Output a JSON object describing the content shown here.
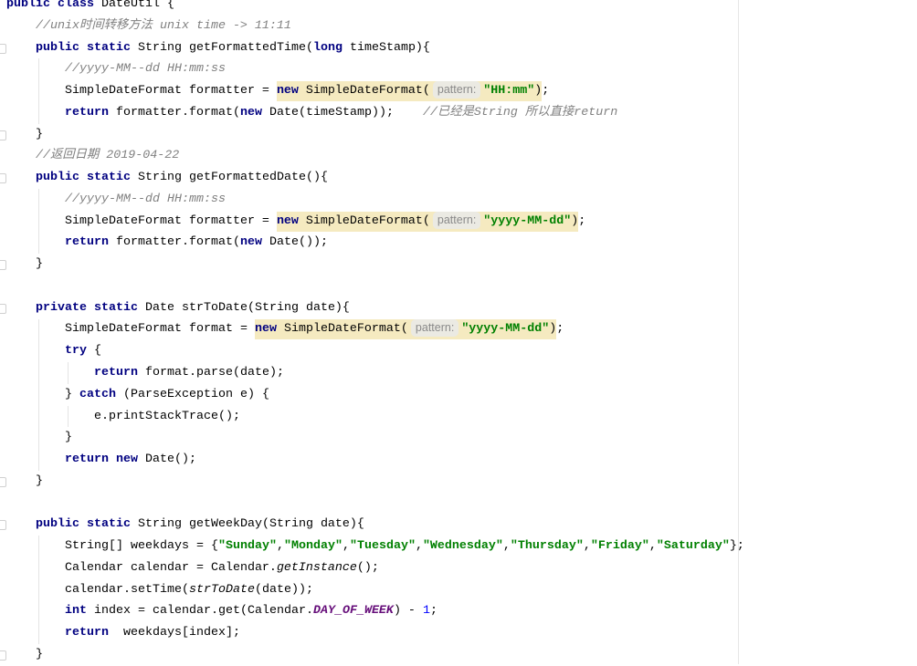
{
  "code_lines": [
    [
      {
        "t": "public class ",
        "c": "kw"
      },
      {
        "t": "DateUtil {"
      }
    ],
    [
      {
        "t": "    "
      },
      {
        "t": "//unix时间转移方法 unix time -> 11:11",
        "c": "cmt"
      }
    ],
    [
      {
        "t": "    "
      },
      {
        "t": "public static ",
        "c": "kw"
      },
      {
        "t": "String getFormattedTime("
      },
      {
        "t": "long ",
        "c": "kw"
      },
      {
        "t": "timeStamp){"
      }
    ],
    [
      {
        "t": "        "
      },
      {
        "t": "//yyyy-MM--dd HH:mm:ss",
        "c": "cmt"
      }
    ],
    [
      {
        "t": "        SimpleDateFormat formatter = "
      },
      {
        "t": "new",
        "c": "kw",
        "hl": true
      },
      {
        "t": " SimpleDateFormat(",
        "hl": true
      },
      {
        "t": "pattern:",
        "c": "hint",
        "hl": true
      },
      {
        "t": "\"HH:mm\"",
        "c": "str",
        "hl": true
      },
      {
        "t": ")",
        "hl": true
      },
      {
        "t": ";"
      }
    ],
    [
      {
        "t": "        "
      },
      {
        "t": "return ",
        "c": "kw"
      },
      {
        "t": "formatter.format("
      },
      {
        "t": "new ",
        "c": "kw"
      },
      {
        "t": "Date(timeStamp));    "
      },
      {
        "t": "//已经是String 所以直接return",
        "c": "cmt"
      }
    ],
    [
      {
        "t": "    }"
      }
    ],
    [
      {
        "t": "    "
      },
      {
        "t": "//返回日期 2019-04-22",
        "c": "cmt"
      }
    ],
    [
      {
        "t": "    "
      },
      {
        "t": "public static ",
        "c": "kw"
      },
      {
        "t": "String getFormattedDate(){"
      }
    ],
    [
      {
        "t": "        "
      },
      {
        "t": "//yyyy-MM--dd HH:mm:ss",
        "c": "cmt"
      }
    ],
    [
      {
        "t": "        SimpleDateFormat formatter = "
      },
      {
        "t": "new",
        "c": "kw",
        "hl": true
      },
      {
        "t": " SimpleDateFormat(",
        "hl": true
      },
      {
        "t": "pattern:",
        "c": "hint",
        "hl": true
      },
      {
        "t": "\"yyyy-MM-dd\"",
        "c": "str",
        "hl": true
      },
      {
        "t": ")",
        "hl": true
      },
      {
        "t": ";"
      }
    ],
    [
      {
        "t": "        "
      },
      {
        "t": "return ",
        "c": "kw"
      },
      {
        "t": "formatter.format("
      },
      {
        "t": "new ",
        "c": "kw"
      },
      {
        "t": "Date());"
      }
    ],
    [
      {
        "t": "    }"
      }
    ],
    [
      {
        "t": ""
      }
    ],
    [
      {
        "t": "    "
      },
      {
        "t": "private static ",
        "c": "kw"
      },
      {
        "t": "Date strToDate(String date){"
      }
    ],
    [
      {
        "t": "        SimpleDateFormat format = "
      },
      {
        "t": "new",
        "c": "kw",
        "hl": true
      },
      {
        "t": " SimpleDateFormat(",
        "hl": true
      },
      {
        "t": "pattern:",
        "c": "hint",
        "hl": true
      },
      {
        "t": "\"yyyy-MM-dd\"",
        "c": "str",
        "hl": true
      },
      {
        "t": ")",
        "hl": true
      },
      {
        "t": ";"
      }
    ],
    [
      {
        "t": "        "
      },
      {
        "t": "try ",
        "c": "kw"
      },
      {
        "t": "{"
      }
    ],
    [
      {
        "t": "            "
      },
      {
        "t": "return ",
        "c": "kw"
      },
      {
        "t": "format.parse(date);"
      }
    ],
    [
      {
        "t": "        } "
      },
      {
        "t": "catch ",
        "c": "kw"
      },
      {
        "t": "(ParseException e) {"
      }
    ],
    [
      {
        "t": "            e.printStackTrace();"
      }
    ],
    [
      {
        "t": "        }"
      }
    ],
    [
      {
        "t": "        "
      },
      {
        "t": "return new ",
        "c": "kw"
      },
      {
        "t": "Date();"
      }
    ],
    [
      {
        "t": "    }"
      }
    ],
    [
      {
        "t": ""
      }
    ],
    [
      {
        "t": "    "
      },
      {
        "t": "public static ",
        "c": "kw"
      },
      {
        "t": "String getWeekDay(String date){"
      }
    ],
    [
      {
        "t": "        String[] weekdays = {"
      },
      {
        "t": "\"Sunday\"",
        "c": "str"
      },
      {
        "t": ","
      },
      {
        "t": "\"Monday\"",
        "c": "str"
      },
      {
        "t": ","
      },
      {
        "t": "\"Tuesday\"",
        "c": "str"
      },
      {
        "t": ","
      },
      {
        "t": "\"Wednesday\"",
        "c": "str"
      },
      {
        "t": ","
      },
      {
        "t": "\"Thursday\"",
        "c": "str"
      },
      {
        "t": ","
      },
      {
        "t": "\"Friday\"",
        "c": "str"
      },
      {
        "t": ","
      },
      {
        "t": "\"Saturday\"",
        "c": "str"
      },
      {
        "t": "};"
      }
    ],
    [
      {
        "t": "        Calendar calendar = Calendar."
      },
      {
        "t": "getInstance",
        "c": "ital"
      },
      {
        "t": "();"
      }
    ],
    [
      {
        "t": "        calendar.setTime("
      },
      {
        "t": "strToDate",
        "c": "ital"
      },
      {
        "t": "(date));"
      }
    ],
    [
      {
        "t": "        "
      },
      {
        "t": "int ",
        "c": "kw"
      },
      {
        "t": "index = calendar.get(Calendar."
      },
      {
        "t": "DAY_OF_WEEK",
        "c": "field"
      },
      {
        "t": ") - "
      },
      {
        "t": "1",
        "c": "num"
      },
      {
        "t": ";"
      }
    ],
    [
      {
        "t": "        "
      },
      {
        "t": "return  ",
        "c": "kw"
      },
      {
        "t": "weekdays[index];"
      }
    ],
    [
      {
        "t": "    }"
      }
    ]
  ]
}
